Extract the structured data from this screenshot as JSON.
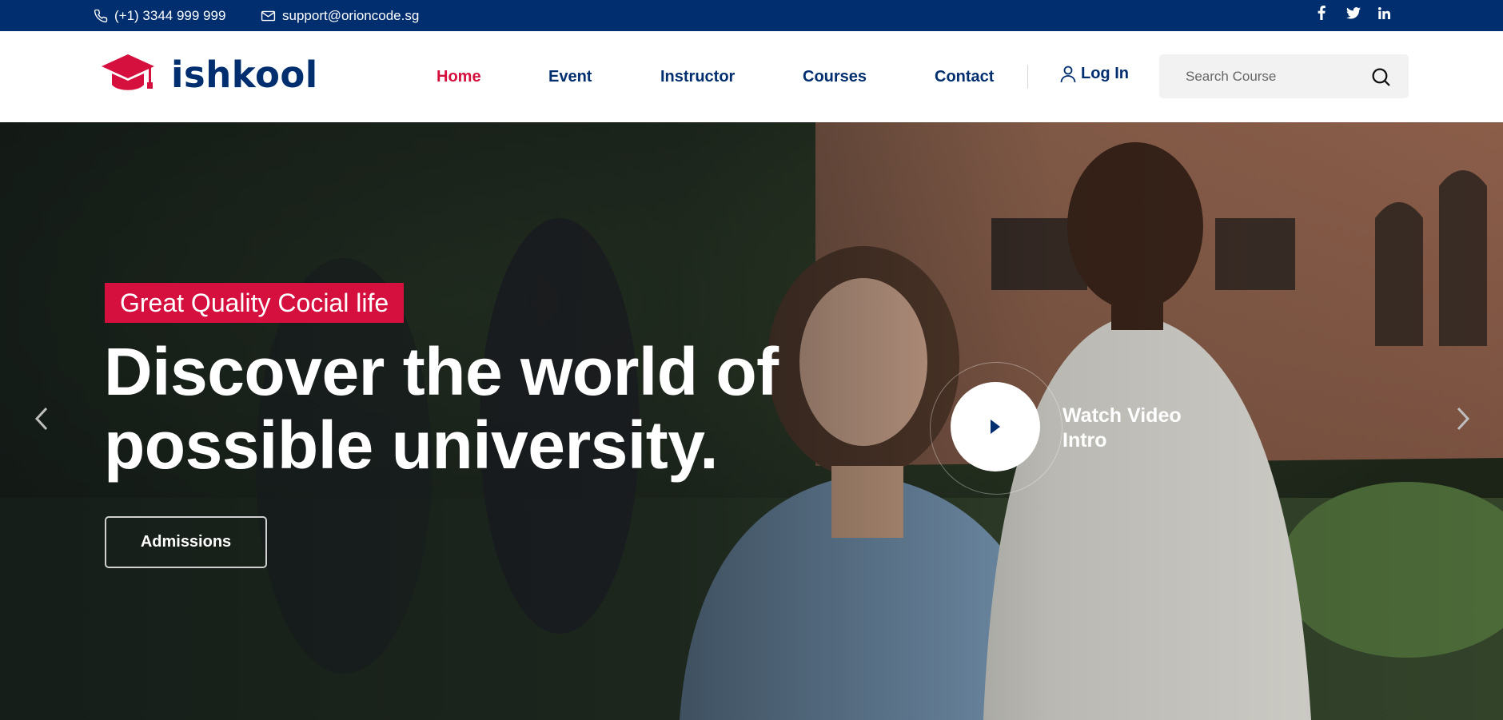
{
  "topbar": {
    "phone": "(+1) 3344 999 999",
    "email": "support@orioncode.sg",
    "social": [
      "facebook-icon",
      "twitter-icon",
      "linkedin-icon"
    ]
  },
  "header": {
    "logo_text": "ishkool",
    "nav": [
      {
        "label": "Home",
        "active": true
      },
      {
        "label": "Event",
        "active": false
      },
      {
        "label": "Instructor",
        "active": false
      },
      {
        "label": "Courses",
        "active": false
      },
      {
        "label": "Contact",
        "active": false
      }
    ],
    "login_label": "Log In",
    "search_placeholder": "Search Course"
  },
  "hero": {
    "tagline": "Great Quality Cocial life",
    "headline_line1": "Discover the world of",
    "headline_line2": "possible university.",
    "admissions_label": "Admissions",
    "watch_line1": "Watch Video",
    "watch_line2": "Intro"
  },
  "colors": {
    "brand_navy": "#002e6e",
    "accent_red": "#d6103e",
    "search_bg": "#f2f2f2"
  }
}
